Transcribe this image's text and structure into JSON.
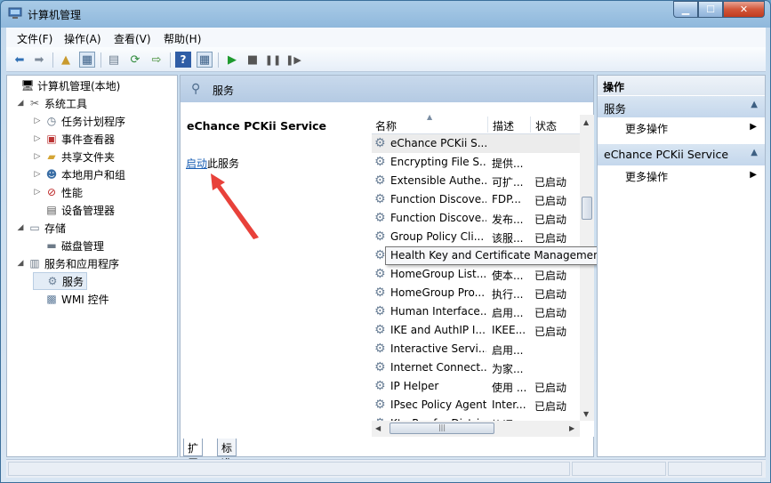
{
  "window": {
    "title": "计算机管理",
    "colors": {
      "accent": "#1a5fb4",
      "close": "#c03b1f",
      "header": "#b4cae3"
    }
  },
  "menu": [
    "文件(F)",
    "操作(A)",
    "查看(V)",
    "帮助(H)"
  ],
  "tree": [
    {
      "label": "计算机管理(本地)",
      "icon": "computer-icon",
      "exp": ""
    },
    {
      "label": "系统工具",
      "icon": "tools-icon",
      "exp": "◢"
    },
    {
      "label": "任务计划程序",
      "icon": "clock-icon",
      "exp": "▷"
    },
    {
      "label": "事件查看器",
      "icon": "event-viewer-icon",
      "exp": "▷"
    },
    {
      "label": "共享文件夹",
      "icon": "shared-folder-icon",
      "exp": "▷"
    },
    {
      "label": "本地用户和组",
      "icon": "users-icon",
      "exp": "▷"
    },
    {
      "label": "性能",
      "icon": "performance-icon",
      "exp": "▷"
    },
    {
      "label": "设备管理器",
      "icon": "device-manager-icon",
      "exp": ""
    },
    {
      "label": "存储",
      "icon": "storage-icon",
      "exp": "◢"
    },
    {
      "label": "磁盘管理",
      "icon": "disk-icon",
      "exp": ""
    },
    {
      "label": "服务和应用程序",
      "icon": "services-apps-icon",
      "exp": "◢"
    },
    {
      "label": "服务",
      "icon": "gear-icon",
      "exp": ""
    },
    {
      "label": "WMI 控件",
      "icon": "wmi-icon",
      "exp": ""
    }
  ],
  "center": {
    "header": "服务",
    "service_name": "eChance PCKii Service",
    "start_link": "启动",
    "start_suffix": "此服务"
  },
  "list": {
    "columns": [
      "名称",
      "描述",
      "状态"
    ],
    "rows": [
      {
        "name": "eChance PCKii S...",
        "desc": "",
        "status": ""
      },
      {
        "name": "Encrypting File S...",
        "desc": "提供...",
        "status": ""
      },
      {
        "name": "Extensible Authe...",
        "desc": "可扩...",
        "status": "已启动"
      },
      {
        "name": "Function Discove...",
        "desc": "FDP...",
        "status": "已启动"
      },
      {
        "name": "Function Discove...",
        "desc": "发布...",
        "status": "已启动"
      },
      {
        "name": "Group Policy Cli...",
        "desc": "该服...",
        "status": "已启动"
      },
      {
        "name": "",
        "desc": "",
        "status": ""
      },
      {
        "name": "HomeGroup List...",
        "desc": "使本...",
        "status": "已启动"
      },
      {
        "name": "HomeGroup Pro...",
        "desc": "执行...",
        "status": "已启动"
      },
      {
        "name": "Human Interface...",
        "desc": "启用...",
        "status": "已启动"
      },
      {
        "name": "IKE and AuthIP I...",
        "desc": "IKEE...",
        "status": "已启动"
      },
      {
        "name": "Interactive Servi...",
        "desc": "启用...",
        "status": ""
      },
      {
        "name": "Internet Connect...",
        "desc": "为家...",
        "status": ""
      },
      {
        "name": "IP Helper",
        "desc": "使用 ...",
        "status": "已启动"
      },
      {
        "name": "IPsec Policy Agent",
        "desc": "Inter...",
        "status": "已启动"
      },
      {
        "name": "KtmRm for Distri...",
        "desc": "协调...",
        "status": ""
      }
    ],
    "tooltip": "Health Key and Certificate Management"
  },
  "tabs": [
    "扩展",
    "标准"
  ],
  "actions": {
    "header": "操作",
    "section1": "服务",
    "item1": "更多操作",
    "section2": "eChance PCKii Service",
    "item2": "更多操作"
  }
}
